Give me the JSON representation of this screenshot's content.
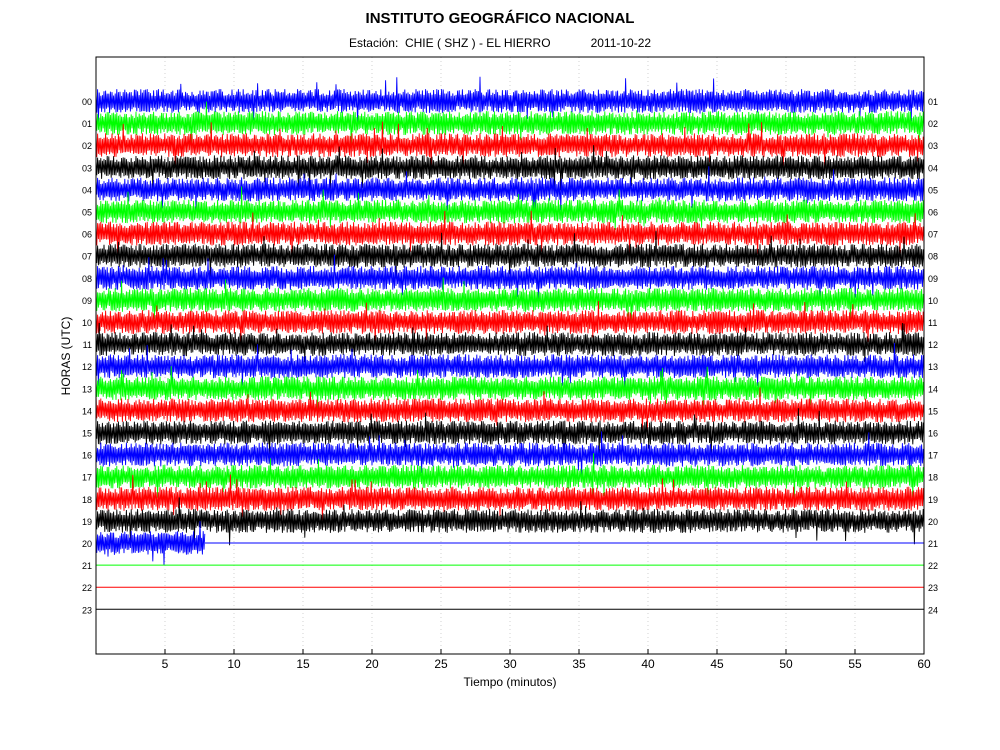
{
  "chart_data": {
    "type": "line",
    "title": "INSTITUTO GEOGRÁFICO NACIONAL",
    "station_label": "Estación:",
    "station": "CHIE ( SHZ ) - EL HIERRO",
    "date": "2011-10-22",
    "xlabel": "Tiempo (minutos)",
    "ylabel": "HORAS (UTC)",
    "xlim": [
      0,
      60
    ],
    "x_ticks": [
      5,
      10,
      15,
      20,
      25,
      30,
      35,
      40,
      45,
      50,
      55,
      60
    ],
    "grid": true,
    "trace_colors": [
      "#0000ff",
      "#00ff00",
      "#ff0000",
      "#000000"
    ],
    "left_hour_labels": [
      "00",
      "01",
      "02",
      "03",
      "04",
      "05",
      "06",
      "07",
      "08",
      "09",
      "10",
      "11",
      "12",
      "13",
      "14",
      "15",
      "16",
      "17",
      "18",
      "19",
      "20",
      "21",
      "22",
      "23"
    ],
    "right_hour_labels": [
      "01",
      "02",
      "03",
      "04",
      "05",
      "06",
      "07",
      "08",
      "09",
      "10",
      "11",
      "12",
      "13",
      "14",
      "15",
      "16",
      "17",
      "18",
      "19",
      "20",
      "21",
      "22",
      "23",
      "24"
    ],
    "series": [
      {
        "hour": "00",
        "color": "#0000ff",
        "end_minute": 60
      },
      {
        "hour": "01",
        "color": "#00ff00",
        "end_minute": 60
      },
      {
        "hour": "02",
        "color": "#ff0000",
        "end_minute": 60
      },
      {
        "hour": "03",
        "color": "#000000",
        "end_minute": 60
      },
      {
        "hour": "04",
        "color": "#0000ff",
        "end_minute": 60
      },
      {
        "hour": "05",
        "color": "#00ff00",
        "end_minute": 60
      },
      {
        "hour": "06",
        "color": "#ff0000",
        "end_minute": 60
      },
      {
        "hour": "07",
        "color": "#000000",
        "end_minute": 60
      },
      {
        "hour": "08",
        "color": "#0000ff",
        "end_minute": 60
      },
      {
        "hour": "09",
        "color": "#00ff00",
        "end_minute": 60
      },
      {
        "hour": "10",
        "color": "#ff0000",
        "end_minute": 60
      },
      {
        "hour": "11",
        "color": "#000000",
        "end_minute": 60
      },
      {
        "hour": "12",
        "color": "#0000ff",
        "end_minute": 60
      },
      {
        "hour": "13",
        "color": "#00ff00",
        "end_minute": 60
      },
      {
        "hour": "14",
        "color": "#ff0000",
        "end_minute": 60
      },
      {
        "hour": "15",
        "color": "#000000",
        "end_minute": 60
      },
      {
        "hour": "16",
        "color": "#0000ff",
        "end_minute": 60
      },
      {
        "hour": "17",
        "color": "#00ff00",
        "end_minute": 60
      },
      {
        "hour": "18",
        "color": "#ff0000",
        "end_minute": 60
      },
      {
        "hour": "19",
        "color": "#000000",
        "end_minute": 60
      },
      {
        "hour": "20",
        "color": "#0000ff",
        "end_minute": 7.9
      },
      {
        "hour": "21",
        "color": "#00ff00",
        "end_minute": 0
      },
      {
        "hour": "22",
        "color": "#ff0000",
        "end_minute": 0
      },
      {
        "hour": "23",
        "color": "#000000",
        "end_minute": 0
      }
    ]
  }
}
